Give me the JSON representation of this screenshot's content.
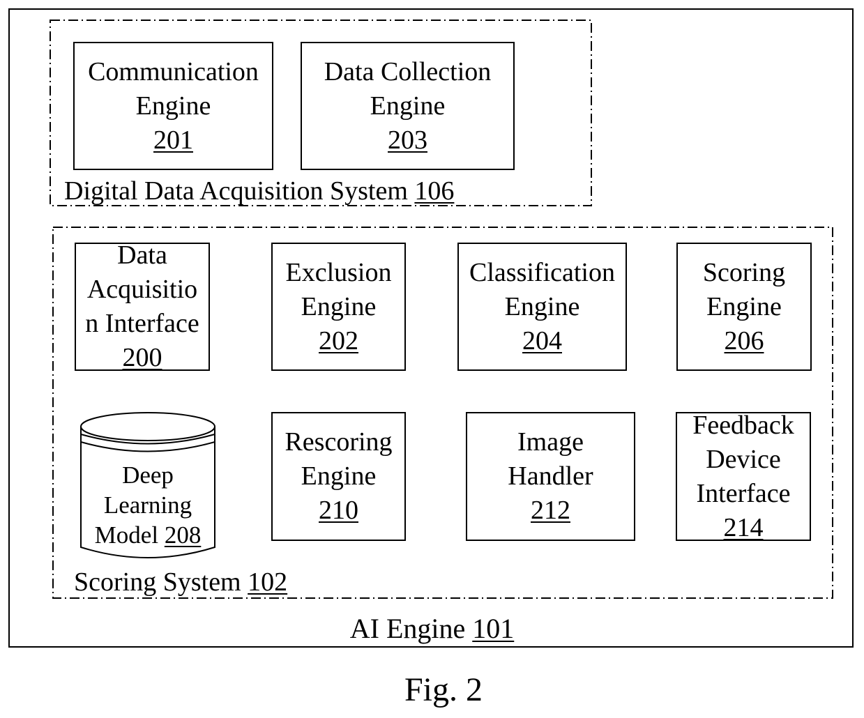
{
  "figure_label": "Fig. 2",
  "ai_engine": {
    "label": "AI Engine",
    "ref": "101"
  },
  "digital_data_acquisition_system": {
    "label": "Digital Data Acquisition System",
    "ref": "106",
    "components": [
      {
        "lines": [
          "Communication",
          "Engine"
        ],
        "ref": "201"
      },
      {
        "lines": [
          "Data Collection",
          "Engine"
        ],
        "ref": "203"
      }
    ]
  },
  "scoring_system": {
    "label": "Scoring System",
    "ref": "102",
    "components": [
      {
        "lines": [
          "Data",
          "Acquisitio",
          "n Interface"
        ],
        "ref": "200"
      },
      {
        "lines": [
          "Exclusion",
          "Engine"
        ],
        "ref": "202"
      },
      {
        "lines": [
          "Classification",
          "Engine"
        ],
        "ref": "204"
      },
      {
        "lines": [
          "Scoring",
          "Engine"
        ],
        "ref": "206"
      },
      {
        "lines": [
          "Deep",
          "Learning",
          "Model"
        ],
        "ref": "208",
        "shape": "cylinder"
      },
      {
        "lines": [
          "Rescoring",
          "Engine"
        ],
        "ref": "210"
      },
      {
        "lines": [
          "Image",
          "Handler"
        ],
        "ref": "212"
      },
      {
        "lines": [
          "Feedback",
          "Device",
          "Interface"
        ],
        "ref": "214"
      }
    ]
  }
}
